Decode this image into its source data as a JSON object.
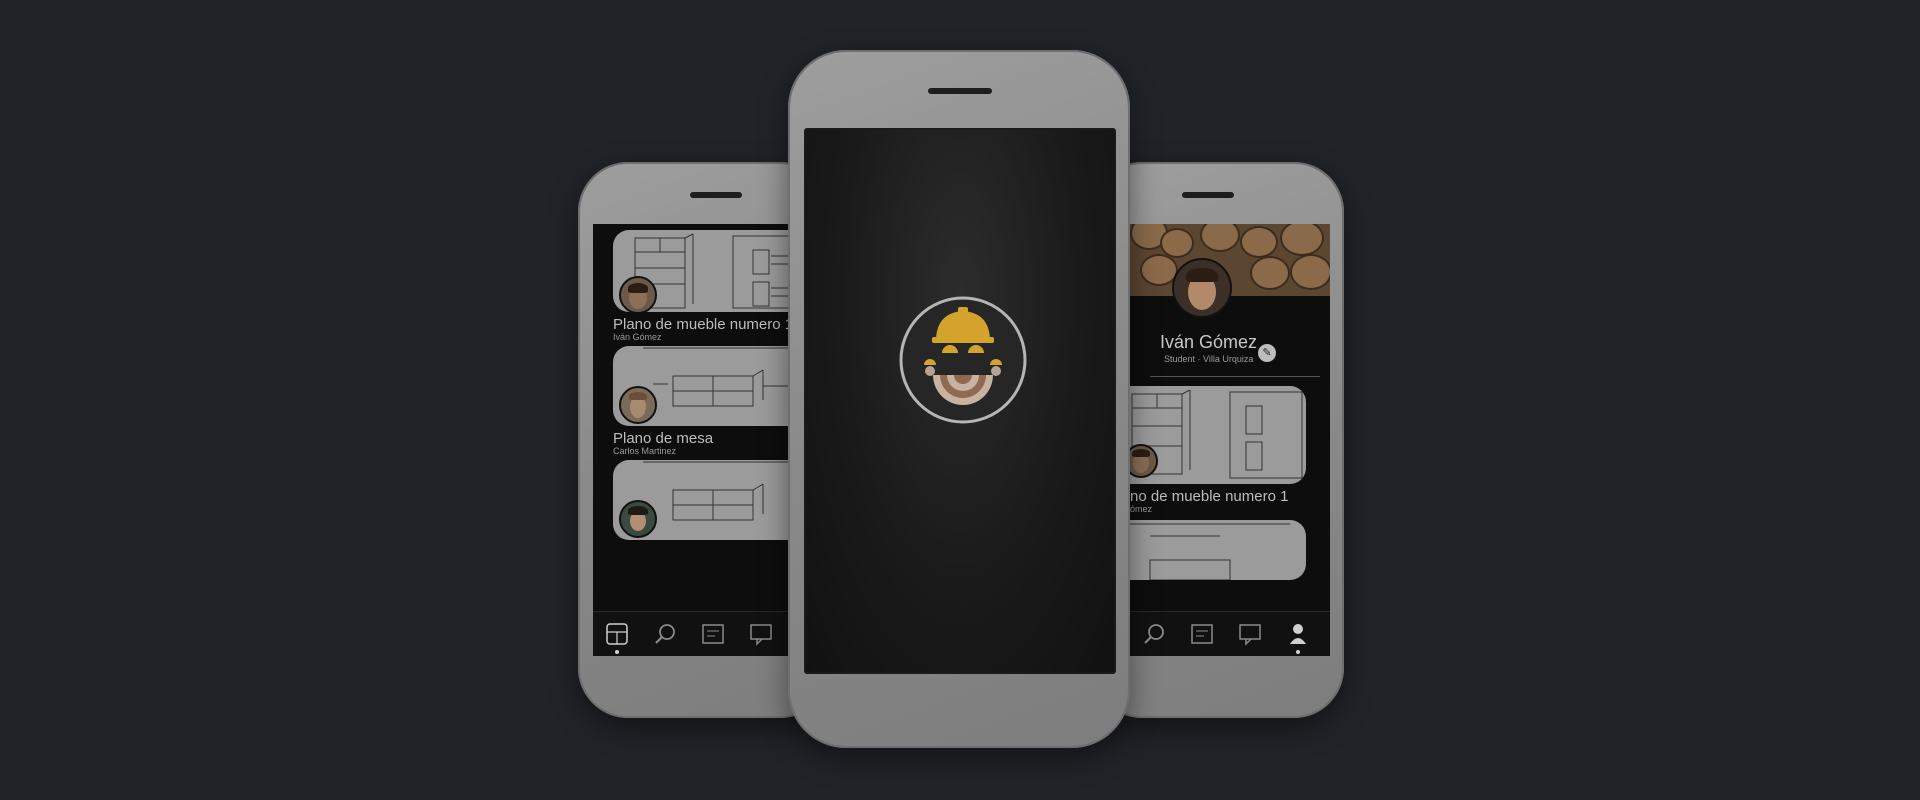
{
  "left_phone": {
    "feed": [
      {
        "title": "Plano de mueble numero 1",
        "author": "Iván Gómez"
      },
      {
        "title": "Plano de mesa",
        "author": "Carlos Martinez"
      },
      {
        "title": "",
        "author": ""
      }
    ],
    "nav": [
      {
        "icon": "home-plans-icon",
        "active": true
      },
      {
        "icon": "search-icon",
        "active": false
      },
      {
        "icon": "plans-icon",
        "active": false
      },
      {
        "icon": "messages-icon",
        "active": false
      }
    ]
  },
  "center_phone": {
    "splash_logo": "carpenter-helmet-logo",
    "colors": {
      "helmet": "#d4a32c",
      "rings": "#c9b3a0",
      "background": "#1a1a1a"
    }
  },
  "right_phone": {
    "profile": {
      "name": "Iván Gómez",
      "subtitle": "Student · Villa Urquiza",
      "edit_icon": "pencil-icon"
    },
    "feed": [
      {
        "title": "no de mueble numero 1",
        "author": "ómez"
      }
    ],
    "nav": [
      {
        "icon": "search-icon",
        "active": false
      },
      {
        "icon": "plans-icon",
        "active": false
      },
      {
        "icon": "messages-icon",
        "active": false
      },
      {
        "icon": "profile-icon",
        "active": true
      }
    ]
  }
}
